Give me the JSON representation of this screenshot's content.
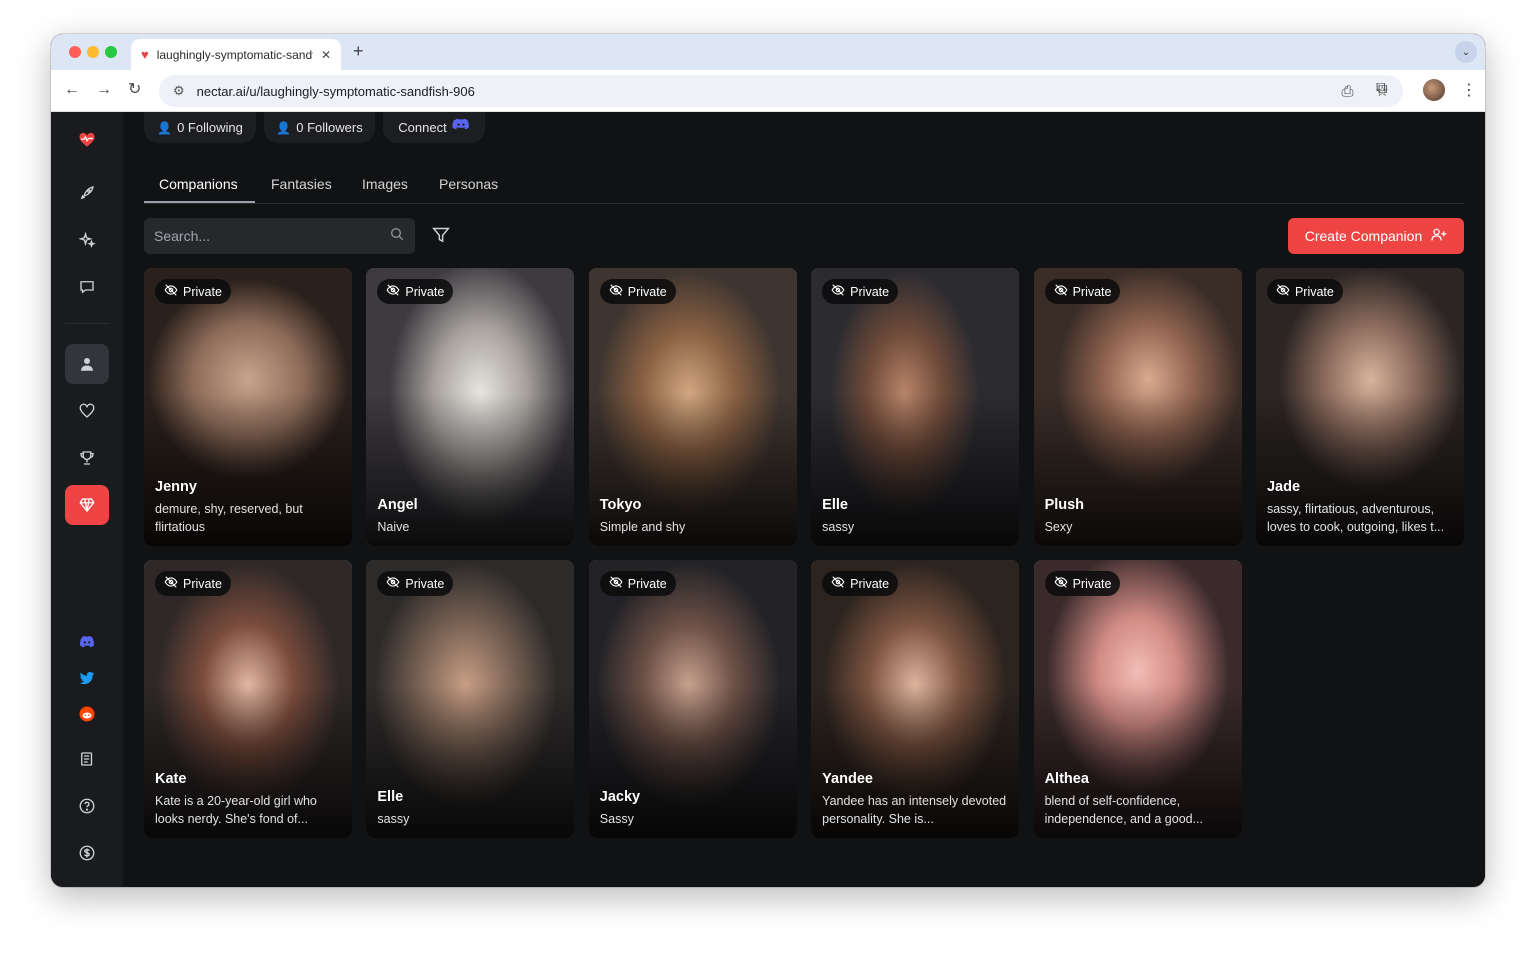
{
  "browser": {
    "tab_title": "laughingly-symptomatic-sandfish-906",
    "url": "nectar.ai/u/laughingly-symptomatic-sandfish-906"
  },
  "profile": {
    "following": "0 Following",
    "followers": "0 Followers",
    "connect": "Connect"
  },
  "tabs": [
    "Companions",
    "Fantasies",
    "Images",
    "Personas"
  ],
  "active_tab": "Companions",
  "search": {
    "placeholder": "Search..."
  },
  "create_button": "Create Companion",
  "badge_label": "Private",
  "companions": [
    {
      "name": "Jenny",
      "description": "demure, shy, reserved, but flirtatious"
    },
    {
      "name": "Angel",
      "description": "Naive"
    },
    {
      "name": "Tokyo",
      "description": "Simple and shy"
    },
    {
      "name": "Elle",
      "description": "sassy"
    },
    {
      "name": "Plush",
      "description": "Sexy"
    },
    {
      "name": "Jade",
      "description": "sassy, flirtatious, adventurous, loves to cook, outgoing, likes t..."
    },
    {
      "name": "Kate",
      "description": "Kate is a 20-year-old girl who looks nerdy. She's fond of..."
    },
    {
      "name": "Elle",
      "description": "sassy"
    },
    {
      "name": "Jacky",
      "description": "Sassy"
    },
    {
      "name": "Yandee",
      "description": "Yandee has an intensely devoted personality. She is..."
    },
    {
      "name": "Althea",
      "description": "blend of self-confidence, independence, and a good..."
    }
  ],
  "colors": {
    "accent": "#ef4444",
    "background": "#111214",
    "sidebar": "#1a1b1e",
    "discord": "#5865f2",
    "twitter": "#1d9bf0",
    "reddit": "#ff4500"
  },
  "sidebar_icons": [
    "heart-pulse-icon",
    "rocket-icon",
    "sparkles-icon",
    "chat-icon",
    "user-icon",
    "heart-icon",
    "trophy-icon",
    "gem-icon",
    "discord-icon",
    "twitter-icon",
    "reddit-icon",
    "docs-icon",
    "help-icon",
    "dollar-icon"
  ]
}
